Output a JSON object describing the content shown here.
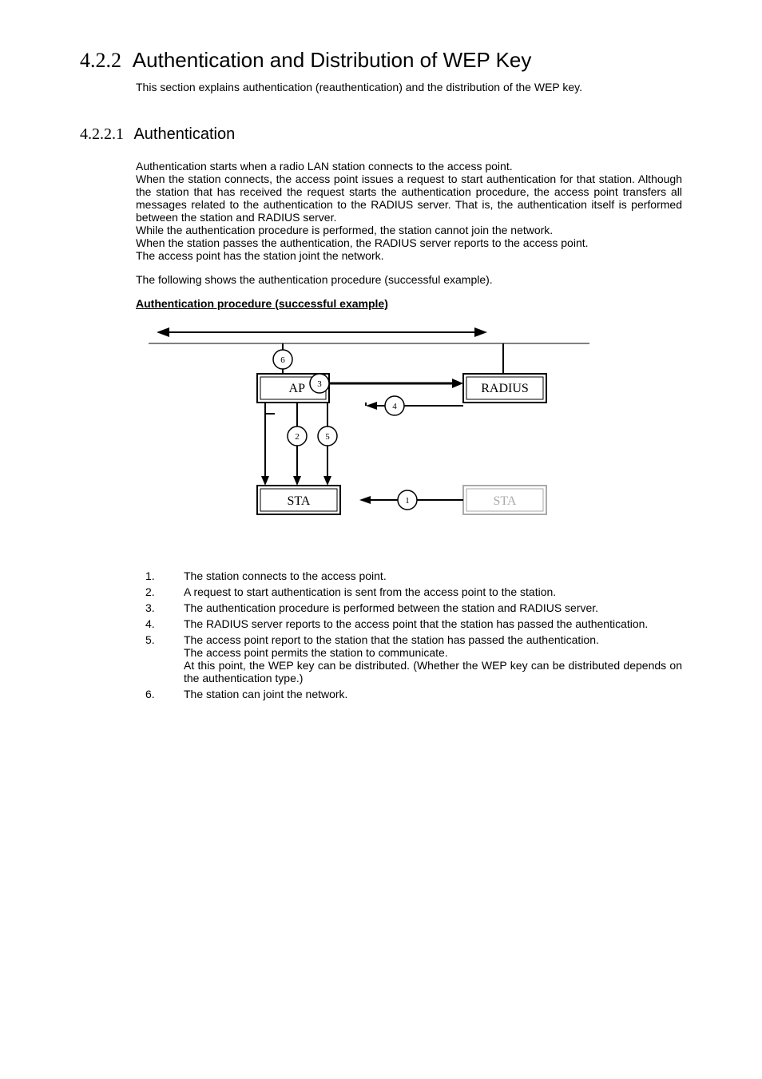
{
  "section": {
    "number": "4.2.2",
    "title": "Authentication and Distribution of WEP Key",
    "intro": "This section explains authentication (reauthentication) and the distribution of the WEP key."
  },
  "subsection": {
    "number": "4.2.2.1",
    "title": "Authentication",
    "paragraph1_lines": {
      "l1": "Authentication starts when a radio LAN station connects to the access point.",
      "l2": "When the station connects, the access point issues a request to start authentication for that station.  Although the station that has received the request starts the authentication procedure, the access point transfers all messages related to the authentication to the RADIUS server.   That is, the authentication itself is performed between the station and RADIUS server.",
      "l3": "While the authentication procedure is performed, the station cannot join the network.",
      "l4": "When the station passes the authentication, the RADIUS server reports to the access point.",
      "l5": "The access point has the station joint the network."
    },
    "paragraph2": "The following shows the authentication procedure (successful example).",
    "subheader": "Authentication procedure (successful example)",
    "diagram": {
      "ap": "AP",
      "radius": "RADIUS",
      "sta1": "STA",
      "sta2": "STA",
      "n1": "1",
      "n2": "2",
      "n3": "3",
      "n4": "4",
      "n5": "5",
      "n6": "6"
    },
    "steps": [
      {
        "n": "1.",
        "t": "The station connects to the access point."
      },
      {
        "n": "2.",
        "t": "A request to start authentication is sent from the access point to the station."
      },
      {
        "n": "3.",
        "t": "The authentication procedure is performed between the station and RADIUS server."
      },
      {
        "n": "4.",
        "t": "The RADIUS server reports to the access point that the station has passed the authentication."
      },
      {
        "n": "5.",
        "t": "The access point report to the station that the station has passed the authentication.\nThe access point permits the station to communicate.\nAt this point, the WEP key can be distributed.   (Whether the WEP key can be distributed depends on the authentication type.)"
      },
      {
        "n": "6.",
        "t": "The station can joint the network."
      }
    ]
  }
}
